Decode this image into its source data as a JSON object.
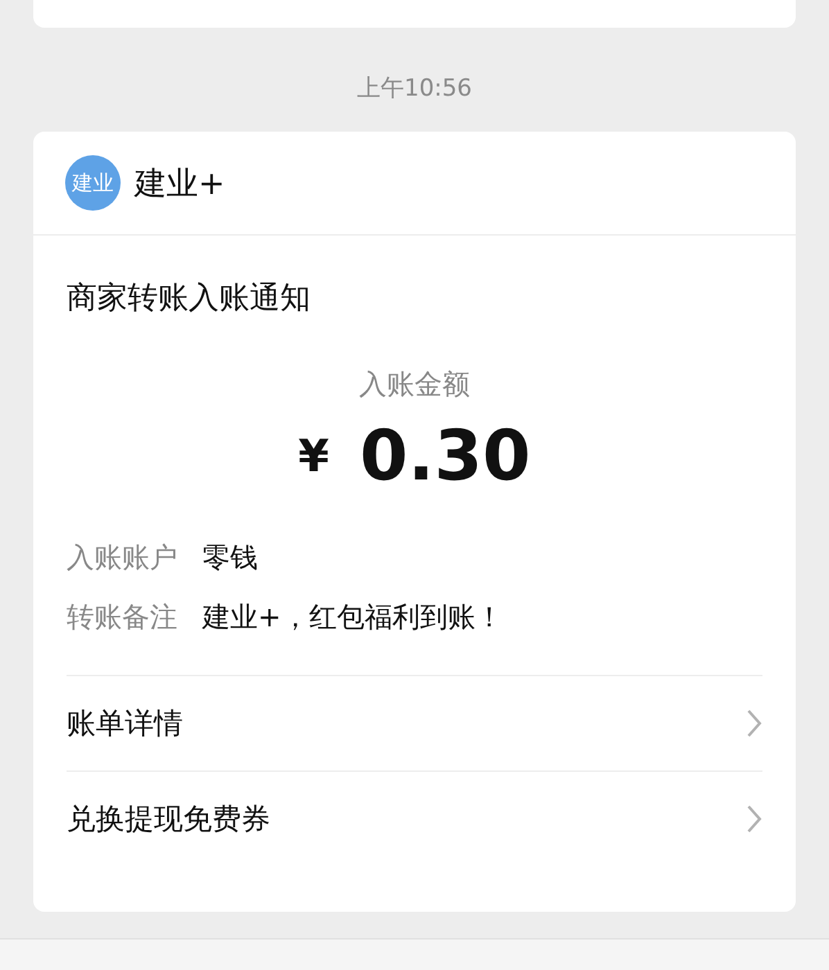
{
  "timestamp": "上午10:56",
  "card": {
    "logo_text": "建业",
    "sender": "建业+",
    "title": "商家转账入账通知",
    "amount_label": "入账金额",
    "currency": "¥",
    "amount": "0.30",
    "fields": [
      {
        "label": "入账账户",
        "value": "零钱"
      },
      {
        "label": "转账备注",
        "value": "建业+，红包福利到账！"
      }
    ],
    "links": [
      "账单详情",
      "兑换提现免费券"
    ]
  }
}
